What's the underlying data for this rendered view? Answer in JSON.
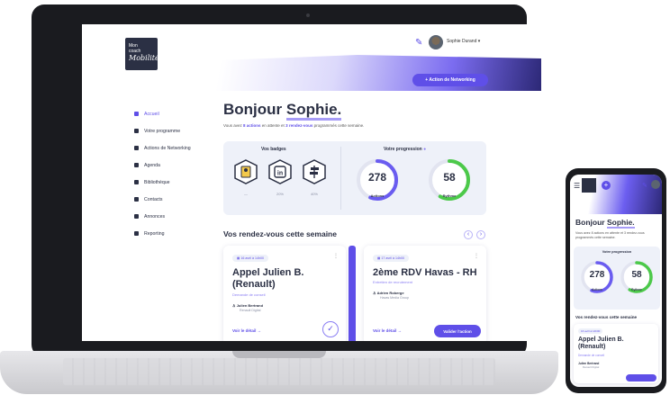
{
  "app": {
    "logo_lines": [
      "Mon",
      "coach"
    ],
    "logo_script": "Mobilité",
    "user_name": "Sophie Durand",
    "networking_button": "+ Action de Networking"
  },
  "sidebar": {
    "items": [
      {
        "label": "Accueil",
        "icon": "home-icon",
        "active": true
      },
      {
        "label": "Votre programme",
        "icon": "program-icon"
      },
      {
        "label": "Actions de Networking",
        "icon": "network-icon"
      },
      {
        "label": "Agenda",
        "icon": "calendar-icon"
      },
      {
        "label": "Bibliothèque",
        "icon": "library-icon"
      },
      {
        "label": "Contacts",
        "icon": "contacts-icon"
      },
      {
        "label": "Annonces",
        "icon": "announce-icon"
      },
      {
        "label": "Reporting",
        "icon": "reporting-icon"
      }
    ]
  },
  "main": {
    "greet_prefix": "Bonjour ",
    "greet_name": "Sophie.",
    "sub_1": "Vous avez ",
    "sub_actions": "8 actions",
    "sub_2": " en attente et ",
    "sub_rdv": "3 rendez-vous",
    "sub_3": " programmés cette semaine.",
    "badges_title": "Vos badges",
    "badges": [
      {
        "icon": "id-card-badge-icon",
        "value": "—"
      },
      {
        "icon": "linkedin-badge-icon",
        "value": "20%"
      },
      {
        "icon": "signpost-badge-icon",
        "value": "40%"
      }
    ],
    "progress_title": "Votre progression",
    "progress": [
      {
        "value": "278",
        "unit": "/ 500",
        "label": "Actions",
        "fraction": 0.56,
        "color": "#6a5cf0"
      },
      {
        "value": "58",
        "unit": "%",
        "label": "Rythme",
        "fraction": 0.58,
        "color": "#4cc94a"
      }
    ],
    "rdv_title": "Vos rendez-vous cette semaine",
    "prev_symbol": "‹",
    "next_symbol": "›",
    "cards": [
      {
        "date": "16 avril à 14h00",
        "title": "Appel Julien B. (Renault)",
        "type": "Demande de conseil",
        "contact": "Julien Bertrand",
        "company": "Renault Digital",
        "detail": "Voir le détail →",
        "check_symbol": "✓"
      },
      {
        "date": "17 avril à 14h00",
        "title": "2ème RDV Havas - RH",
        "type": "Entretien de recrutement",
        "contact": "Adrien Roberge",
        "company": "Havas Media Group",
        "detail": "Voir le détail →",
        "action": "Valider l'action"
      }
    ]
  },
  "phone": {
    "greet_prefix": "Bonjour ",
    "greet_name": "Sophie.",
    "sub": "Vous avez 8 actions en attente et 3 rendez-vous programmés cette semaine.",
    "progress_title": "Votre progression",
    "rings": [
      {
        "value": "278",
        "label": "Actions",
        "fraction": 0.56,
        "color": "#6a5cf0"
      },
      {
        "value": "58",
        "label": "Rythme",
        "fraction": 0.58,
        "color": "#4cc94a"
      }
    ],
    "rdv_title": "Vos rendez-vous cette semaine",
    "card": {
      "date": "16 avril à 14h00",
      "title_1": "Appel Julien B.",
      "title_2": "(Renault)",
      "type": "Demande de conseil",
      "contact": "Julien Bertrand",
      "company": "Renault Digital"
    }
  }
}
